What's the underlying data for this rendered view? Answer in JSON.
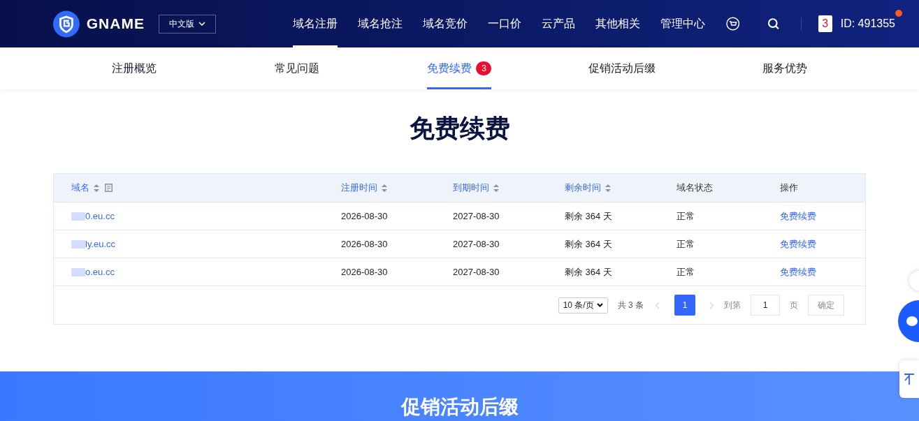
{
  "header": {
    "logo_text": "GNAME",
    "language": "中文版",
    "nav": [
      {
        "label": "域名注册",
        "selected": true
      },
      {
        "label": "域名抢注",
        "selected": false
      },
      {
        "label": "域名竞价",
        "selected": false
      },
      {
        "label": "一口价",
        "selected": false
      },
      {
        "label": "云产品",
        "selected": false
      },
      {
        "label": "其他相关",
        "selected": false
      },
      {
        "label": "管理中心",
        "selected": false
      }
    ],
    "card_digit": "3",
    "user_id": "ID: 491355",
    "notification_dot": true
  },
  "subnav": [
    {
      "label": "注册概览",
      "selected": false
    },
    {
      "label": "常见问题",
      "selected": false
    },
    {
      "label": "免费续费",
      "selected": true,
      "badge": "3"
    },
    {
      "label": "促销活动后缀",
      "selected": false
    },
    {
      "label": "服务优势",
      "selected": false
    }
  ],
  "title": "免费续费",
  "table": {
    "columns": [
      {
        "label": "域名",
        "sortable": true
      },
      {
        "label": "注册时间",
        "sortable": true
      },
      {
        "label": "到期时间",
        "sortable": true
      },
      {
        "label": "剩余时间",
        "sortable": true
      },
      {
        "label": "域名状态",
        "sortable": false
      },
      {
        "label": "操作",
        "sortable": false
      }
    ],
    "rows": [
      {
        "domain": "0.eu.cc",
        "registered": "2026-08-30",
        "expires": "2027-08-30",
        "remaining": "剩余 364 天",
        "status": "正常",
        "action": "免费续费"
      },
      {
        "domain": "ly.eu.cc",
        "registered": "2026-08-30",
        "expires": "2027-08-30",
        "remaining": "剩余 364 天",
        "status": "正常",
        "action": "免费续费"
      },
      {
        "domain": "o.eu.cc",
        "registered": "2026-08-30",
        "expires": "2027-08-30",
        "remaining": "剩余 364 天",
        "status": "正常",
        "action": "免费续费"
      }
    ]
  },
  "pagination": {
    "page_size": "10 条/页",
    "total": "共 3 条",
    "pages": [
      {
        "label": "1",
        "selected": true
      }
    ],
    "goto_label": "到第",
    "goto_value": "1",
    "page_suffix": "页",
    "confirm": "确定"
  },
  "next_section_title": "促销活动后缀"
}
